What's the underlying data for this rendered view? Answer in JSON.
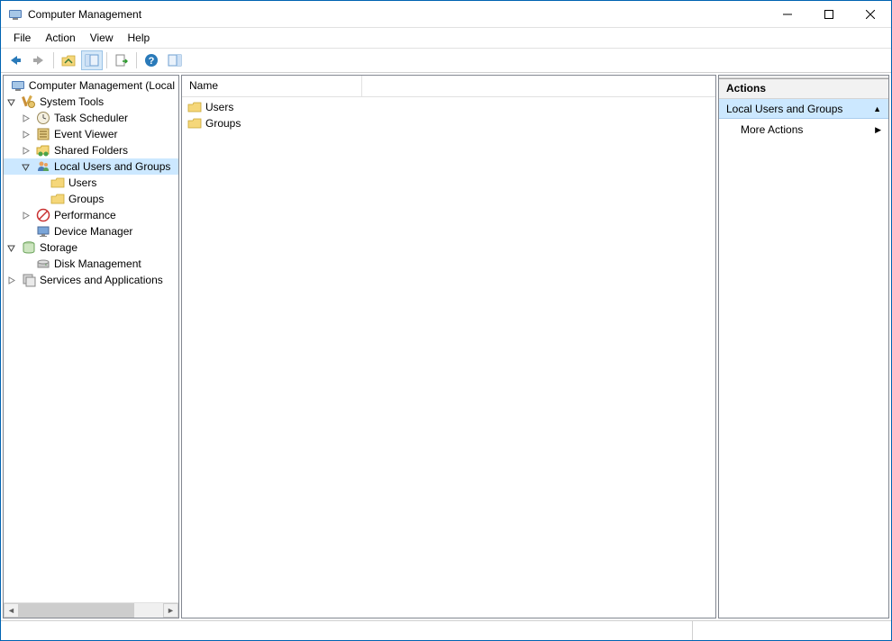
{
  "window": {
    "title": "Computer Management"
  },
  "menu": {
    "items": [
      "File",
      "Action",
      "View",
      "Help"
    ]
  },
  "actions": {
    "title": "Actions",
    "section": "Local Users and Groups",
    "more": "More Actions"
  },
  "list": {
    "header_name": "Name",
    "rows": [
      {
        "label": "Users"
      },
      {
        "label": "Groups"
      }
    ]
  },
  "tree": {
    "root": "Computer Management (Local",
    "system_tools": "System Tools",
    "task_scheduler": "Task Scheduler",
    "event_viewer": "Event Viewer",
    "shared_folders": "Shared Folders",
    "local_users_groups": "Local Users and Groups",
    "users": "Users",
    "groups": "Groups",
    "performance": "Performance",
    "device_manager": "Device Manager",
    "storage": "Storage",
    "disk_management": "Disk Management",
    "services_apps": "Services and Applications"
  }
}
